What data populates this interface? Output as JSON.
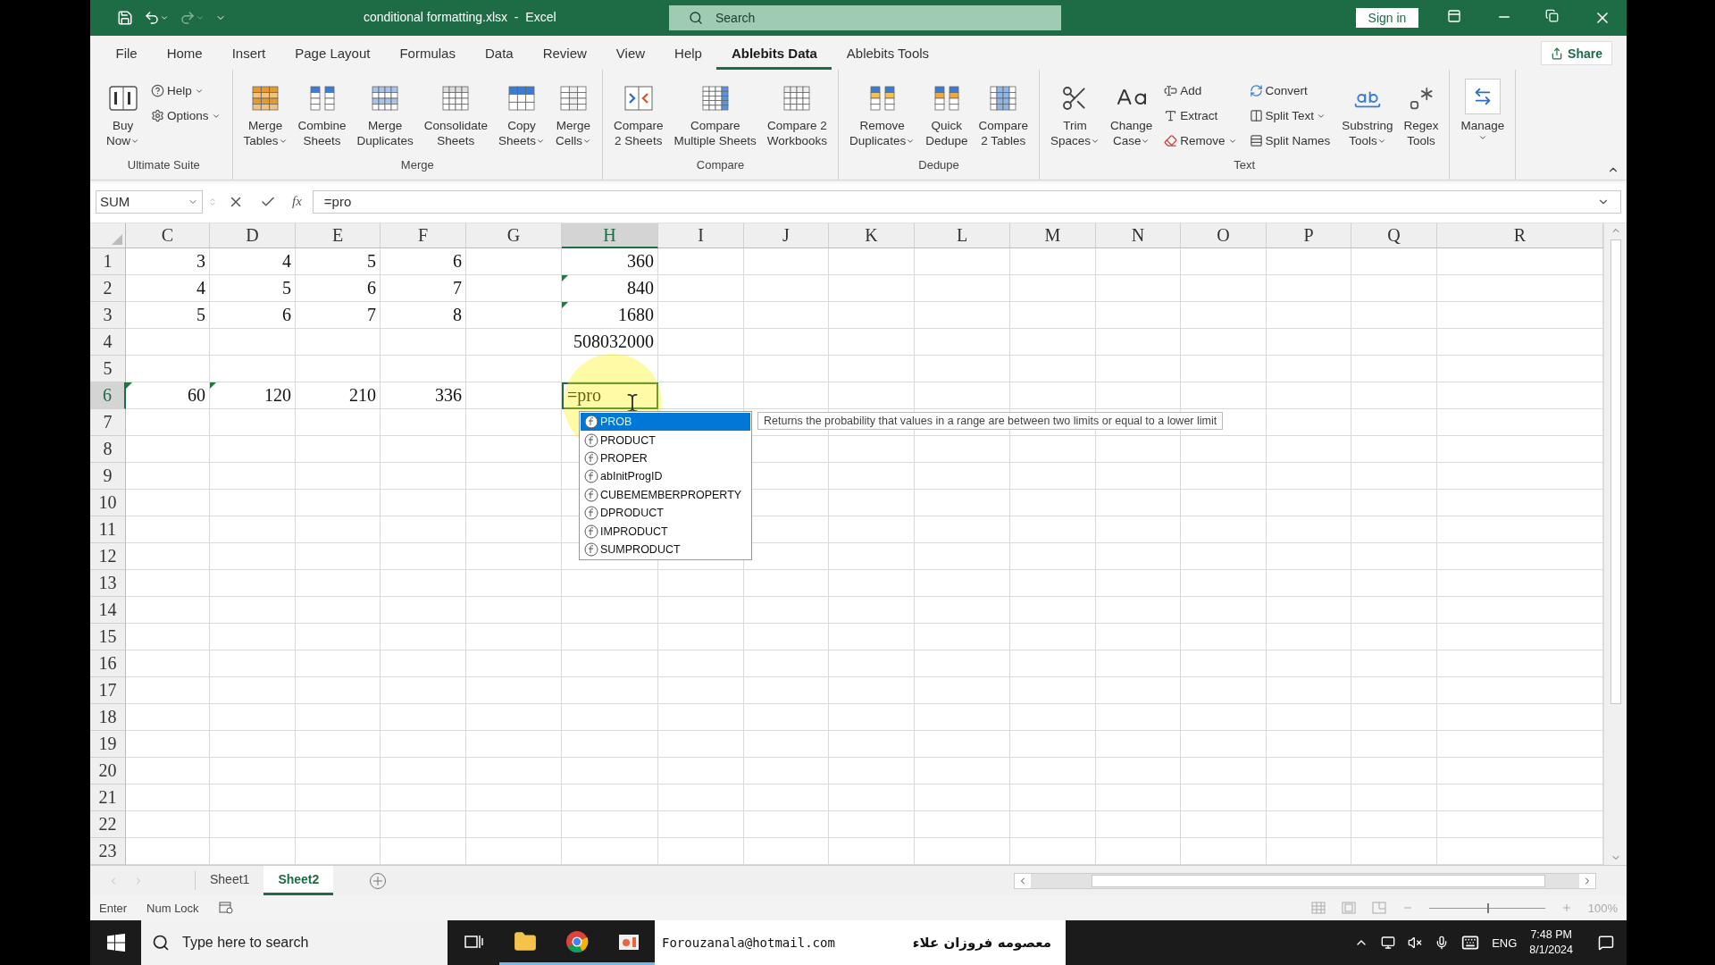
{
  "title_bar": {
    "file_title": "conditional formatting.xlsx  -  Excel",
    "search_placeholder": "Search",
    "sign_in": "Sign in"
  },
  "menu_tabs": [
    {
      "label": "File",
      "selected": false
    },
    {
      "label": "Home",
      "selected": false
    },
    {
      "label": "Insert",
      "selected": false
    },
    {
      "label": "Page Layout",
      "selected": false
    },
    {
      "label": "Formulas",
      "selected": false
    },
    {
      "label": "Data",
      "selected": false
    },
    {
      "label": "Review",
      "selected": false
    },
    {
      "label": "View",
      "selected": false
    },
    {
      "label": "Help",
      "selected": false
    },
    {
      "label": "Ablebits Data",
      "selected": true
    },
    {
      "label": "Ablebits Tools",
      "selected": false
    }
  ],
  "share": "Share",
  "ribbon_groups": [
    {
      "label": "Ultimate Suite",
      "items": [
        {
          "kind": "large",
          "lines": [
            "Buy",
            "Now"
          ],
          "dropdown": true
        },
        {
          "kind": "stack",
          "items": [
            {
              "label": "Help",
              "dropdown": true
            },
            {
              "label": "Options",
              "dropdown": true
            }
          ]
        }
      ]
    },
    {
      "label": "Merge",
      "items": [
        {
          "kind": "large",
          "lines": [
            "Merge",
            "Tables"
          ],
          "dropdown": true
        },
        {
          "kind": "large",
          "lines": [
            "Combine",
            "Sheets"
          ],
          "dropdown": false
        },
        {
          "kind": "large",
          "lines": [
            "Merge",
            "Duplicates"
          ],
          "dropdown": false
        },
        {
          "kind": "large",
          "lines": [
            "Consolidate",
            "Sheets"
          ],
          "dropdown": false
        },
        {
          "kind": "large",
          "lines": [
            "Copy",
            "Sheets"
          ],
          "dropdown": true
        },
        {
          "kind": "large",
          "lines": [
            "Merge",
            "Cells"
          ],
          "dropdown": true
        }
      ]
    },
    {
      "label": "Compare",
      "items": [
        {
          "kind": "large",
          "lines": [
            "Compare",
            "2 Sheets"
          ],
          "dropdown": false
        },
        {
          "kind": "large",
          "lines": [
            "Compare",
            "Multiple Sheets"
          ],
          "dropdown": false
        },
        {
          "kind": "large",
          "lines": [
            "Compare 2",
            "Workbooks"
          ],
          "dropdown": false
        }
      ]
    },
    {
      "label": "Dedupe",
      "items": [
        {
          "kind": "large",
          "lines": [
            "Remove",
            "Duplicates"
          ],
          "dropdown": true
        },
        {
          "kind": "large",
          "lines": [
            "Quick",
            "Dedupe"
          ],
          "dropdown": false
        },
        {
          "kind": "large",
          "lines": [
            "Compare",
            "2 Tables"
          ],
          "dropdown": false
        }
      ]
    },
    {
      "label": "Text",
      "items": [
        {
          "kind": "large",
          "lines": [
            "Trim",
            "Spaces"
          ],
          "dropdown": true
        },
        {
          "kind": "large",
          "lines": [
            "Change",
            "Case"
          ],
          "dropdown": true
        },
        {
          "kind": "stack",
          "items": [
            {
              "label": "Add",
              "dropdown": false
            },
            {
              "label": "Extract",
              "dropdown": false
            },
            {
              "label": "Remove",
              "dropdown": true
            }
          ]
        },
        {
          "kind": "stack",
          "items": [
            {
              "label": "Convert",
              "dropdown": false
            },
            {
              "label": "Split Text",
              "dropdown": true
            },
            {
              "label": "Split Names",
              "dropdown": false
            }
          ]
        },
        {
          "kind": "large",
          "lines": [
            "Substring",
            "Tools"
          ],
          "dropdown": true
        },
        {
          "kind": "large",
          "lines": [
            "Regex",
            "Tools"
          ],
          "dropdown": false
        }
      ]
    },
    {
      "items": [
        {
          "kind": "manage",
          "lines": [
            "Manage"
          ],
          "dropdown": true
        }
      ]
    }
  ],
  "name_box": "SUM",
  "function_button": "fx",
  "formula": "=pro",
  "columns": [
    {
      "label": "C",
      "selected": false
    },
    {
      "label": "D",
      "selected": false
    },
    {
      "label": "E",
      "selected": false
    },
    {
      "label": "F",
      "selected": false
    },
    {
      "label": "G",
      "selected": false
    },
    {
      "label": "H",
      "selected": true
    },
    {
      "label": "I",
      "selected": false
    },
    {
      "label": "J",
      "selected": false
    },
    {
      "label": "K",
      "selected": false
    },
    {
      "label": "L",
      "selected": false
    },
    {
      "label": "M",
      "selected": false
    },
    {
      "label": "N",
      "selected": false
    },
    {
      "label": "O",
      "selected": false
    },
    {
      "label": "P",
      "selected": false
    },
    {
      "label": "Q",
      "selected": false
    },
    {
      "label": "R",
      "selected": false
    }
  ],
  "rows": [
    {
      "label": "1",
      "selected": false,
      "cells": [
        {
          "text": "3",
          "error_marker": false,
          "editing": false
        },
        {
          "text": "4",
          "error_marker": false,
          "editing": false
        },
        {
          "text": "5",
          "error_marker": false,
          "editing": false
        },
        {
          "text": "6",
          "error_marker": false,
          "editing": false
        },
        null,
        {
          "text": "360",
          "error_marker": false,
          "editing": false
        }
      ]
    },
    {
      "label": "2",
      "selected": false,
      "cells": [
        {
          "text": "4",
          "error_marker": false,
          "editing": false
        },
        {
          "text": "5",
          "error_marker": false,
          "editing": false
        },
        {
          "text": "6",
          "error_marker": false,
          "editing": false
        },
        {
          "text": "7",
          "error_marker": false,
          "editing": false
        },
        null,
        {
          "text": "840",
          "error_marker": true,
          "editing": false
        }
      ]
    },
    {
      "label": "3",
      "selected": false,
      "cells": [
        {
          "text": "5",
          "error_marker": false,
          "editing": false
        },
        {
          "text": "6",
          "error_marker": false,
          "editing": false
        },
        {
          "text": "7",
          "error_marker": false,
          "editing": false
        },
        {
          "text": "8",
          "error_marker": false,
          "editing": false
        },
        null,
        {
          "text": "1680",
          "error_marker": true,
          "editing": false
        }
      ]
    },
    {
      "label": "4",
      "selected": false,
      "cells": [
        null,
        null,
        null,
        null,
        null,
        {
          "text": "508032000",
          "error_marker": false,
          "editing": false
        }
      ]
    },
    {
      "label": "5",
      "selected": false
    },
    {
      "label": "6",
      "selected": true,
      "cells": [
        {
          "text": "60",
          "error_marker": true,
          "editing": false
        },
        {
          "text": "120",
          "error_marker": true,
          "editing": false
        },
        {
          "text": "210",
          "error_marker": false,
          "editing": false
        },
        {
          "text": "336",
          "error_marker": false,
          "editing": false
        },
        null,
        {
          "text": "=pro",
          "error_marker": false,
          "editing": true
        }
      ]
    },
    {
      "label": "7",
      "selected": false
    },
    {
      "label": "8",
      "selected": false
    },
    {
      "label": "9",
      "selected": false
    },
    {
      "label": "10",
      "selected": false
    },
    {
      "label": "11",
      "selected": false
    },
    {
      "label": "12",
      "selected": false
    },
    {
      "label": "13",
      "selected": false
    },
    {
      "label": "14",
      "selected": false
    },
    {
      "label": "15",
      "selected": false
    },
    {
      "label": "16",
      "selected": false
    },
    {
      "label": "17",
      "selected": false
    },
    {
      "label": "18",
      "selected": false
    },
    {
      "label": "19",
      "selected": false
    },
    {
      "label": "20",
      "selected": false
    },
    {
      "label": "21",
      "selected": false
    },
    {
      "label": "22",
      "selected": false
    },
    {
      "label": "23",
      "selected": false
    }
  ],
  "autocomplete": {
    "items": [
      {
        "label": "PROB",
        "selected": true
      },
      {
        "label": "PRODUCT",
        "selected": false
      },
      {
        "label": "PROPER",
        "selected": false
      },
      {
        "label": "abInitProgID",
        "selected": false
      },
      {
        "label": "CUBEMEMBERPROPERTY",
        "selected": false
      },
      {
        "label": "DPRODUCT",
        "selected": false
      },
      {
        "label": "IMPRODUCT",
        "selected": false
      },
      {
        "label": "SUMPRODUCT",
        "selected": false
      }
    ],
    "tooltip": "Returns the probability that values in a range are between two limits or equal to a lower limit"
  },
  "sheet_tabs": [
    {
      "label": "Sheet1",
      "selected": false
    },
    {
      "label": "Sheet2",
      "selected": true
    }
  ],
  "status_bar": {
    "mode": "Enter",
    "num_lock": "Num Lock",
    "zoom": {
      "level": 0.5,
      "reading": "100%"
    }
  },
  "taskbar": {
    "search_placeholder": "Type here to search",
    "overlay_email": "Forouzanala@hotmail.com",
    "overlay_name": "معصومه فروزان علاء",
    "language": "ENG",
    "time": "7:48 PM",
    "date": "8/1/2024"
  }
}
